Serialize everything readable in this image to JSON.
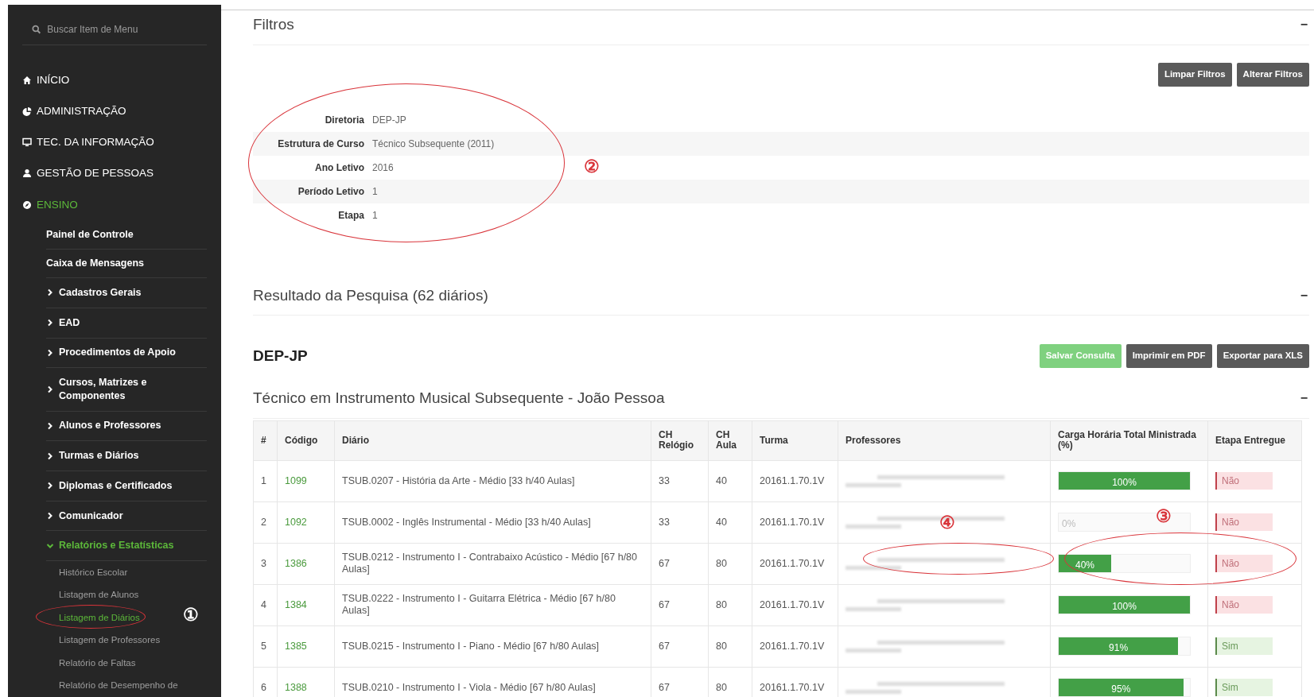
{
  "sidebar": {
    "search": {
      "placeholder": "Buscar Item de Menu"
    },
    "items": [
      {
        "kind": "top",
        "label": "INÍCIO",
        "active": false
      },
      {
        "kind": "top",
        "label": "ADMINISTRAÇÃO",
        "active": false
      },
      {
        "kind": "top",
        "label": "TEC. DA INFORMAÇÃO",
        "active": false
      },
      {
        "kind": "top",
        "label": "GESTÃO DE PESSOAS",
        "active": false
      },
      {
        "kind": "top",
        "label": "ENSINO",
        "active": true
      },
      {
        "kind": "link",
        "label": "Painel de Controle",
        "active": false
      },
      {
        "kind": "link",
        "label": "Caixa de Mensagens",
        "active": false
      },
      {
        "kind": "group",
        "label": "Cadastros Gerais",
        "active": false,
        "expanded": false
      },
      {
        "kind": "group",
        "label": "EAD",
        "active": false,
        "expanded": false
      },
      {
        "kind": "group",
        "label": "Procedimentos de Apoio",
        "active": false,
        "expanded": false
      },
      {
        "kind": "group",
        "label": "Cursos, Matrizes e Componentes",
        "active": false,
        "expanded": false
      },
      {
        "kind": "group",
        "label": "Alunos e Professores",
        "active": false,
        "expanded": false
      },
      {
        "kind": "group",
        "label": "Turmas e Diários",
        "active": false,
        "expanded": false
      },
      {
        "kind": "group",
        "label": "Diplomas e Certificados",
        "active": false,
        "expanded": false
      },
      {
        "kind": "group",
        "label": "Comunicador",
        "active": false,
        "expanded": false
      },
      {
        "kind": "group",
        "label": "Relatórios e Estatísticas",
        "active": true,
        "expanded": true
      },
      {
        "kind": "sub",
        "label": "Histórico Escolar",
        "active": false
      },
      {
        "kind": "sub",
        "label": "Listagem de Alunos",
        "active": false
      },
      {
        "kind": "sub",
        "label": "Listagem de Diários",
        "active": true
      },
      {
        "kind": "sub",
        "label": "Listagem de Professores",
        "active": false
      },
      {
        "kind": "sub",
        "label": "Relatório de Faltas",
        "active": false
      },
      {
        "kind": "sub",
        "label": "Relatório de Desempenho de",
        "active": false
      }
    ]
  },
  "filters": {
    "title": "Filtros",
    "collapse": "−",
    "buttons": [
      "Limpar Filtros",
      "Alterar Filtros"
    ],
    "fields": [
      {
        "label": "Diretoria",
        "value": "DEP-JP"
      },
      {
        "label": "Estrutura de Curso",
        "value": "Técnico Subsequente (2011)"
      },
      {
        "label": "Ano Letivo",
        "value": "2016"
      },
      {
        "label": "Período Letivo",
        "value": "1"
      },
      {
        "label": "Etapa",
        "value": "1"
      }
    ]
  },
  "results": {
    "title": "Resultado da Pesquisa (62 diários)",
    "collapse": "−",
    "group": "DEP-JP",
    "buttons": [
      {
        "label": "Salvar Consulta",
        "kind": "primary"
      },
      {
        "label": "Imprimir em PDF",
        "kind": "dark"
      },
      {
        "label": "Exportar para XLS",
        "kind": "dark"
      }
    ],
    "course": {
      "title": "Técnico em Instrumento Musical Subsequente - João Pessoa",
      "collapse": "−"
    },
    "columns": [
      "#",
      "Código",
      "Diário",
      "CH Relógio",
      "CH Aula",
      "Turma",
      "Professores",
      "Carga Horária Total Ministrada (%)",
      "Etapa Entregue"
    ],
    "rows": [
      {
        "n": "1",
        "code": "1099",
        "diary": "TSUB.0207 - História da Arte - Médio [33 h/40 Aulas]",
        "ch_clock": "33",
        "ch_class": "40",
        "class": "20161.1.70.1V",
        "level": 1.0,
        "percent": "100%",
        "delivered": false,
        "delivered_label": "Não"
      },
      {
        "n": "2",
        "code": "1092",
        "diary": "TSUB.0002 - Inglês Instrumental - Médio [33 h/40 Aulas]",
        "ch_clock": "33",
        "ch_class": "40",
        "class": "20161.1.70.1V",
        "level": 0.0,
        "percent": "0%",
        "delivered": false,
        "delivered_label": "Não"
      },
      {
        "n": "3",
        "code": "1386",
        "diary": "TSUB.0212 - Instrumento I - Contrabaixo Acústico - Médio [67 h/80 Aulas]",
        "ch_clock": "67",
        "ch_class": "80",
        "class": "20161.1.70.1V",
        "level": 0.4,
        "percent": "40%",
        "delivered": false,
        "delivered_label": "Não"
      },
      {
        "n": "4",
        "code": "1384",
        "diary": "TSUB.0222 - Instrumento I - Guitarra Elétrica - Médio [67 h/80 Aulas]",
        "ch_clock": "67",
        "ch_class": "80",
        "class": "20161.1.70.1V",
        "level": 1.0,
        "percent": "100%",
        "delivered": false,
        "delivered_label": "Não"
      },
      {
        "n": "5",
        "code": "1385",
        "diary": "TSUB.0215 - Instrumento I - Piano - Médio [67 h/80 Aulas]",
        "ch_clock": "67",
        "ch_class": "80",
        "class": "20161.1.70.1V",
        "level": 0.91,
        "percent": "91%",
        "delivered": true,
        "delivered_label": "Sim"
      },
      {
        "n": "6",
        "code": "1388",
        "diary": "TSUB.0210 - Instrumento I - Viola - Médio [67 h/80 Aulas]",
        "ch_clock": "67",
        "ch_class": "80",
        "class": "20161.1.70.1V",
        "level": 0.95,
        "percent": "95%",
        "delivered": true,
        "delivered_label": "Sim"
      }
    ]
  },
  "annotations": [
    "①",
    "②",
    "③",
    "④"
  ]
}
